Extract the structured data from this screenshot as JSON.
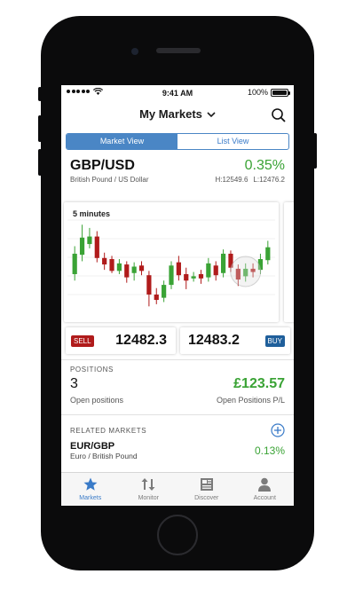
{
  "status_bar": {
    "time": "9:41 AM",
    "battery": "100%",
    "battery_level": 1.0
  },
  "header": {
    "title": "My Markets"
  },
  "view_toggle": {
    "options": [
      "Market View",
      "List View"
    ],
    "selected": "Market View"
  },
  "market": {
    "pair": "GBP/USD",
    "description": "British Pound / US Dollar",
    "change": "0.35%",
    "high": "H:12549.6",
    "low": "L:12476.2"
  },
  "chart": {
    "label": "5 minutes"
  },
  "chart_data": {
    "type": "candlestick",
    "candles": [
      {
        "open": 5.2,
        "close": 3.3,
        "high": 2.6,
        "low": 5.8
      },
      {
        "open": 3.4,
        "close": 1.8,
        "high": 0.6,
        "low": 4.0
      },
      {
        "open": 2.4,
        "close": 1.7,
        "high": 0.9,
        "low": 2.8
      },
      {
        "open": 1.7,
        "close": 3.7,
        "high": 1.2,
        "low": 4.1
      },
      {
        "open": 3.7,
        "close": 4.3,
        "high": 3.2,
        "low": 4.8
      },
      {
        "open": 3.8,
        "close": 4.9,
        "high": 3.5,
        "low": 5.1
      },
      {
        "open": 4.9,
        "close": 4.2,
        "high": 3.8,
        "low": 5.2
      },
      {
        "open": 4.3,
        "close": 5.5,
        "high": 4.0,
        "low": 6.0
      },
      {
        "open": 5.1,
        "close": 4.5,
        "high": 4.1,
        "low": 5.8
      },
      {
        "open": 4.4,
        "close": 4.9,
        "high": 4.0,
        "low": 5.3
      },
      {
        "open": 5.3,
        "close": 7.1,
        "high": 4.9,
        "low": 8.2
      },
      {
        "open": 7.1,
        "close": 7.6,
        "high": 6.5,
        "low": 8.0
      },
      {
        "open": 7.4,
        "close": 6.2,
        "high": 5.8,
        "low": 7.8
      },
      {
        "open": 6.2,
        "close": 4.4,
        "high": 4.0,
        "low": 6.6
      },
      {
        "open": 4.1,
        "close": 5.3,
        "high": 3.5,
        "low": 5.8
      },
      {
        "open": 5.2,
        "close": 5.8,
        "high": 4.6,
        "low": 6.6
      },
      {
        "open": 5.6,
        "close": 5.4,
        "high": 5.0,
        "low": 5.9
      },
      {
        "open": 5.2,
        "close": 5.6,
        "high": 4.8,
        "low": 6.1
      },
      {
        "open": 5.5,
        "close": 4.2,
        "high": 3.7,
        "low": 5.9
      },
      {
        "open": 4.4,
        "close": 5.3,
        "high": 4.0,
        "low": 5.8
      },
      {
        "open": 5.1,
        "close": 3.3,
        "high": 2.9,
        "low": 5.5
      },
      {
        "open": 3.3,
        "close": 4.6,
        "high": 3.0,
        "low": 5.0
      },
      {
        "open": 4.7,
        "close": 5.7,
        "high": 4.3,
        "low": 6.3
      },
      {
        "open": 5.4,
        "close": 4.7,
        "high": 4.2,
        "low": 5.9
      },
      {
        "open": 4.7,
        "close": 5.0,
        "high": 4.2,
        "low": 5.5
      },
      {
        "open": 4.8,
        "close": 3.8,
        "high": 3.3,
        "low": 5.2
      },
      {
        "open": 3.9,
        "close": 2.7,
        "high": 2.1,
        "low": 4.3
      }
    ]
  },
  "trade": {
    "sell_label": "SELL",
    "sell_price": "12482.3",
    "buy_label": "BUY",
    "buy_price": "12483.2"
  },
  "positions": {
    "section_label": "POSITIONS",
    "count": "3",
    "count_label": "Open positions",
    "pl": "£123.57",
    "pl_label": "Open Positions P/L"
  },
  "related": {
    "section_label": "RELATED MARKETS",
    "pair": "EUR/GBP",
    "description": "Euro / British Pound",
    "change": "0.13%"
  },
  "tabs": [
    {
      "label": "Markets",
      "icon": "star-icon",
      "active": true
    },
    {
      "label": "Monitor",
      "icon": "arrows-updown-icon",
      "active": false
    },
    {
      "label": "Discover",
      "icon": "newspaper-icon",
      "active": false
    },
    {
      "label": "Account",
      "icon": "person-icon",
      "active": false
    }
  ],
  "colors": {
    "accent": "#4a86c5",
    "up": "#3aa335",
    "down": "#b01b1b",
    "buy": "#1f5f9b"
  }
}
